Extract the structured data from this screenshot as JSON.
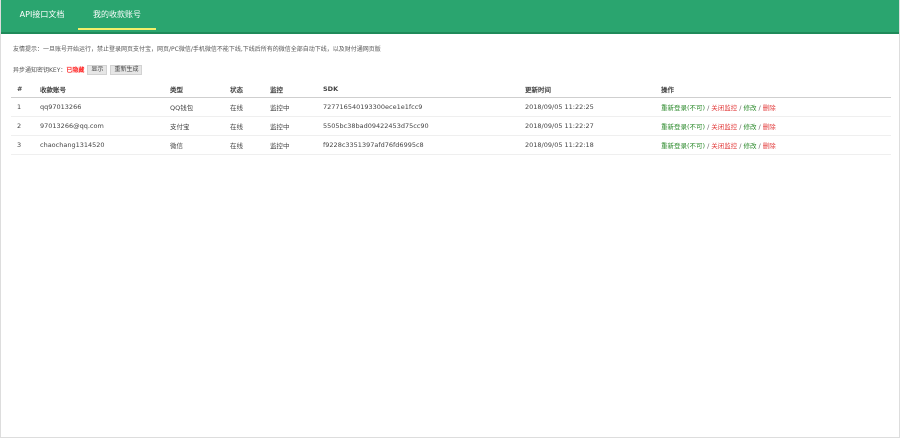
{
  "tabs": [
    {
      "label": "API接口文档"
    },
    {
      "label": "我的收款账号"
    }
  ],
  "notice": "友情提示：一旦账号开始运行，禁止登录网页支付宝，网页/PC微信/手机微信不能下线,下线后所有的微信全部自动下线，以及财付通网页版",
  "key_row": {
    "label": "异步通知密钥KEY：",
    "value": "已隐藏",
    "show_button": "显示",
    "regen_button": "重新生成"
  },
  "table": {
    "headers": [
      "#",
      "收款账号",
      "类型",
      "状态",
      "监控",
      "SDK",
      "更新时间",
      "操作"
    ],
    "rows": [
      {
        "index": "1",
        "account": "qq97013266",
        "type": "QQ钱包",
        "status": "在线",
        "monitor": "监控中",
        "sdk": "727716540193300ece1e1fcc9",
        "updated": "2018/09/05 11:22:25",
        "actions": {
          "relogin": "重新登录(不可)",
          "close": "关闭监控",
          "edit": "修改",
          "delete": "删除"
        }
      },
      {
        "index": "2",
        "account": "97013266@qq.com",
        "type": "支付宝",
        "status": "在线",
        "monitor": "监控中",
        "sdk": "5505bc38bad09422453d75cc90",
        "updated": "2018/09/05 11:22:27",
        "actions": {
          "relogin": "重新登录(不可)",
          "close": "关闭监控",
          "edit": "修改",
          "delete": "删除"
        }
      },
      {
        "index": "3",
        "account": "chaochang1314520",
        "type": "微信",
        "status": "在线",
        "monitor": "监控中",
        "sdk": "f9228c3351397afd76fd6995c8",
        "updated": "2018/09/05 11:22:18",
        "actions": {
          "relogin": "重新登录(不可)",
          "close": "关闭监控",
          "edit": "修改",
          "delete": "删除"
        }
      }
    ]
  },
  "colors": {
    "header_bg": "#2aa56f",
    "tab_underline": "#f3f06a",
    "ok_green": "#2b8a2b",
    "danger_red": "#e23b3b"
  }
}
